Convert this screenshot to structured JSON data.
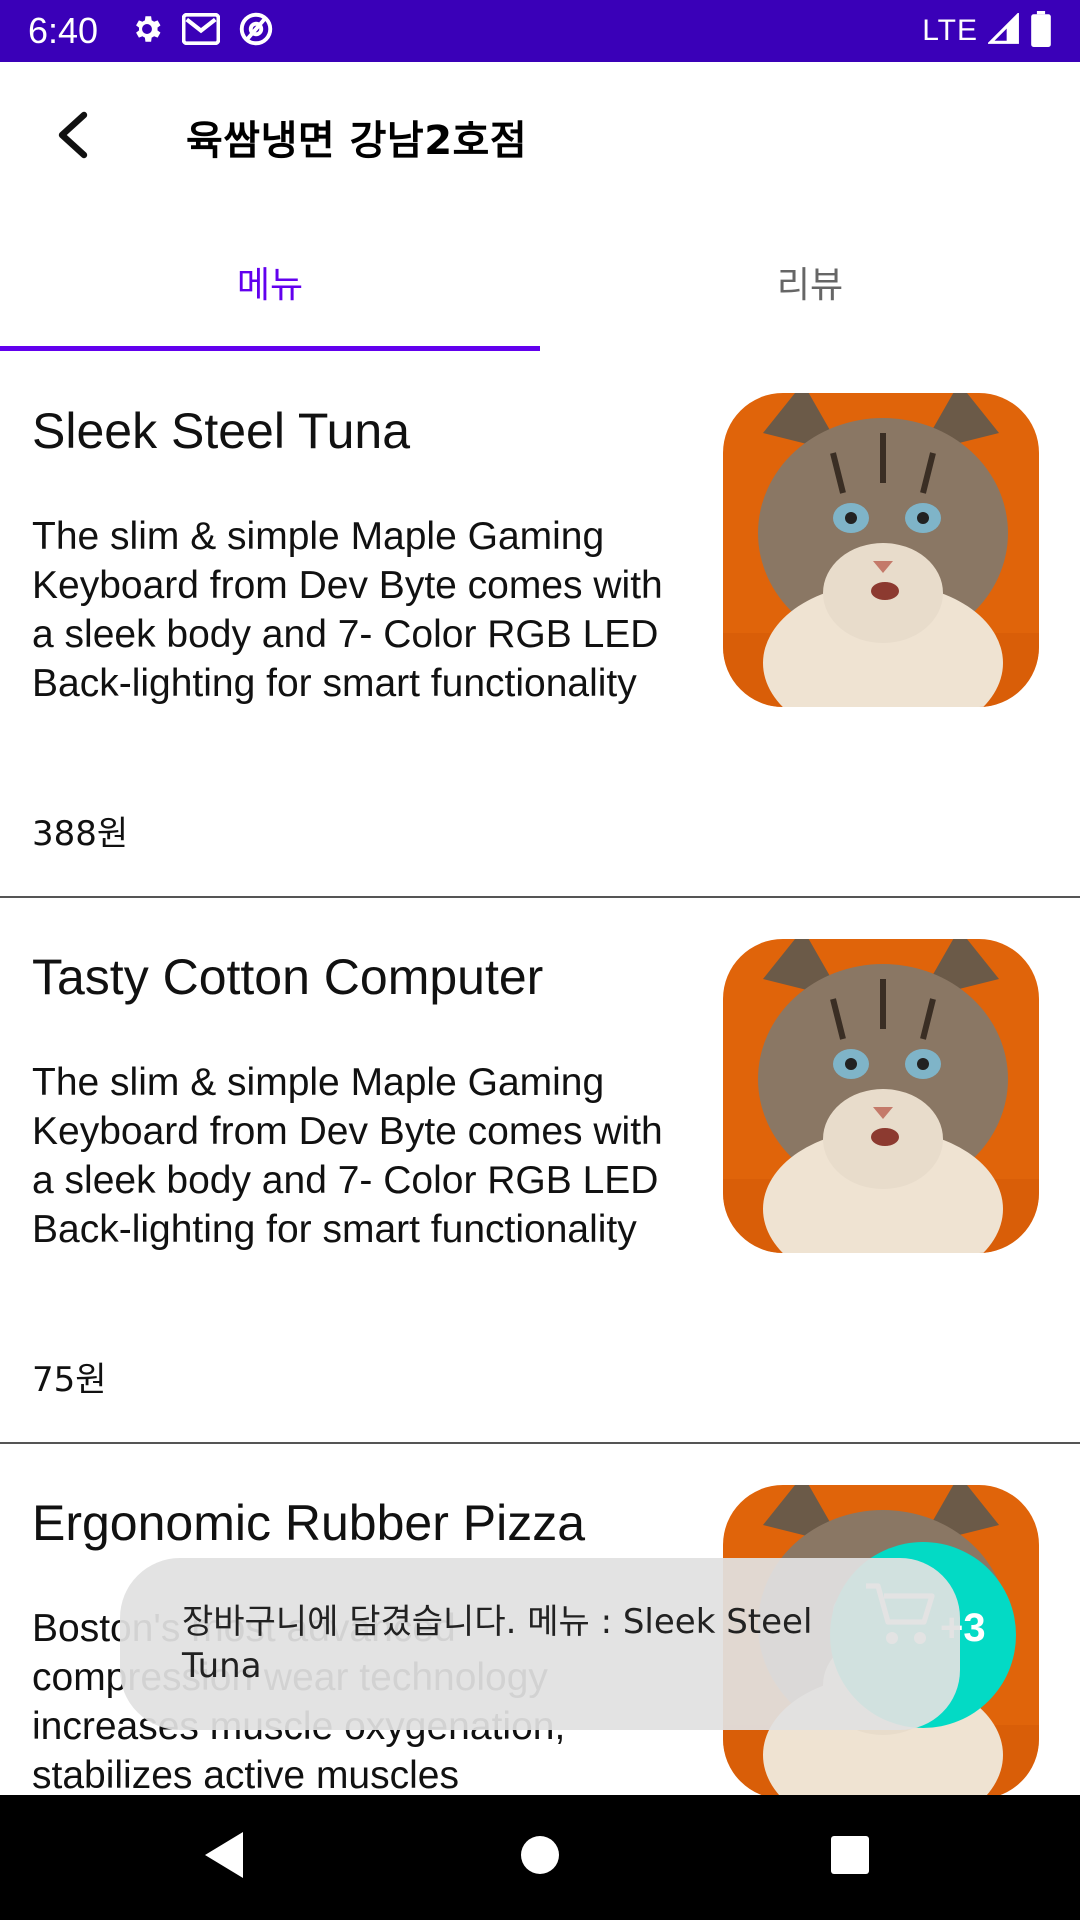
{
  "status_bar": {
    "time": "6:40",
    "network": "LTE",
    "icons": [
      "settings-icon",
      "gmail-icon",
      "at-sign-icon",
      "signal-icon",
      "battery-icon"
    ]
  },
  "toolbar": {
    "back_icon": "chevron-left-icon",
    "title": "육쌈냉면 강남2호점"
  },
  "tabs": [
    {
      "label": "메뉴",
      "active": true
    },
    {
      "label": "리뷰",
      "active": false
    }
  ],
  "colors": {
    "status_bar": "#3a00b8",
    "accent": "#6200ee",
    "fab": "#03dac5"
  },
  "menu_items": [
    {
      "name": "Sleek Steel Tuna",
      "description": "The slim & simple Maple Gaming Keyboard from Dev Byte comes with a sleek body and 7- Color RGB LED Back-lighting for smart functionality",
      "price": "388원"
    },
    {
      "name": "Tasty Cotton Computer",
      "description": "The slim & simple Maple Gaming Keyboard from Dev Byte comes with a sleek body and 7- Color RGB LED Back-lighting for smart functionality",
      "price": "75원"
    },
    {
      "name": "Ergonomic Rubber Pizza",
      "description": "Boston's most advanced compression wear technology increases muscle oxygenation, stabilizes active muscles",
      "price": ""
    }
  ],
  "snackbar": {
    "message": "장바구니에 담겼습니다. 메뉴 : Sleek Steel Tuna"
  },
  "cart_fab": {
    "icon": "cart-icon",
    "count": "+3"
  },
  "nav_bar": {
    "buttons": [
      "back-triangle-icon",
      "home-circle-icon",
      "recents-square-icon"
    ]
  }
}
